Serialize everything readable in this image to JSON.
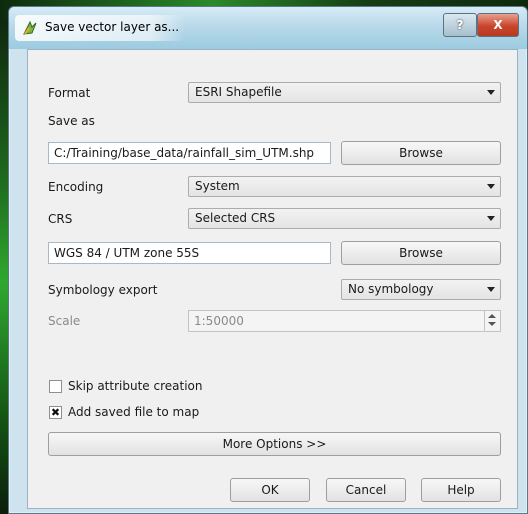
{
  "window": {
    "title": "Save vector layer as...",
    "help_label": "?",
    "close_label": "X",
    "icon": "qgis-icon"
  },
  "form": {
    "format_label": "Format",
    "format_value": "ESRI Shapefile",
    "save_as_label": "Save as",
    "save_as_path": "C:/Training/base_data/rainfall_sim_UTM.shp",
    "browse_label": "Browse",
    "encoding_label": "Encoding",
    "encoding_value": "System",
    "crs_label": "CRS",
    "crs_value": "Selected CRS",
    "crs_text": "WGS 84 / UTM zone 55S",
    "crs_browse_label": "Browse",
    "symbology_label": "Symbology export",
    "symbology_value": "No symbology",
    "scale_label": "Scale",
    "scale_value": "1:50000",
    "skip_attr_label": "Skip attribute creation",
    "skip_attr_checked": false,
    "add_to_map_label": "Add saved file to map",
    "add_to_map_checked": true,
    "add_to_map_mark": "✖",
    "more_options_label": "More Options >>"
  },
  "buttons": {
    "ok": "OK",
    "cancel": "Cancel",
    "help": "Help"
  }
}
